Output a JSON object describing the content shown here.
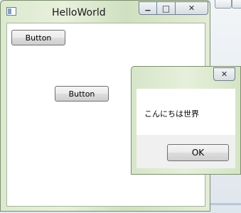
{
  "main_window": {
    "title": "HelloWorld",
    "minimize_glyph": "▁",
    "maximize_glyph": "□",
    "close_glyph": "✕",
    "buttons": [
      {
        "label": "Button"
      },
      {
        "label": "Button"
      }
    ]
  },
  "message_box": {
    "close_glyph": "✕",
    "message": "こんにちは世界",
    "ok_label": "OK"
  },
  "colors": {
    "window_frame": "#dce9cf",
    "client_background": "#ffffff",
    "dialog_footer": "#f0f0f0"
  }
}
